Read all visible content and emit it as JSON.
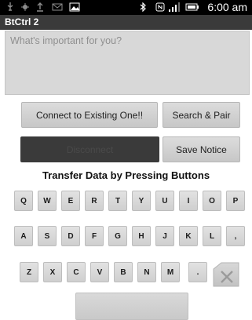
{
  "status_bar": {
    "time": "6:00 am",
    "icons": [
      "usb-icon",
      "usb-debug-icon",
      "upload-icon",
      "email-icon",
      "image-icon",
      "bluetooth-icon",
      "nfc-icon",
      "signal-icon",
      "battery-icon"
    ]
  },
  "app": {
    "title": "BtCtrl 2"
  },
  "notice_field": {
    "placeholder": "What's important for you?",
    "value": ""
  },
  "buttons": {
    "connect_existing": "Connect to Existing One!!",
    "search_pair": "Search & Pair",
    "disconnect": "Disconnect",
    "save_notice": "Save Notice"
  },
  "section_title": "Transfer Data by Pressing Buttons",
  "keyboard": {
    "row1": [
      "Q",
      "W",
      "E",
      "R",
      "T",
      "Y",
      "U",
      "I",
      "O",
      "P"
    ],
    "row2": [
      "A",
      "S",
      "D",
      "F",
      "G",
      "H",
      "J",
      "K",
      "L",
      ","
    ],
    "row3": [
      "Z",
      "X",
      "C",
      "V",
      "B",
      "N",
      "M",
      "."
    ]
  }
}
